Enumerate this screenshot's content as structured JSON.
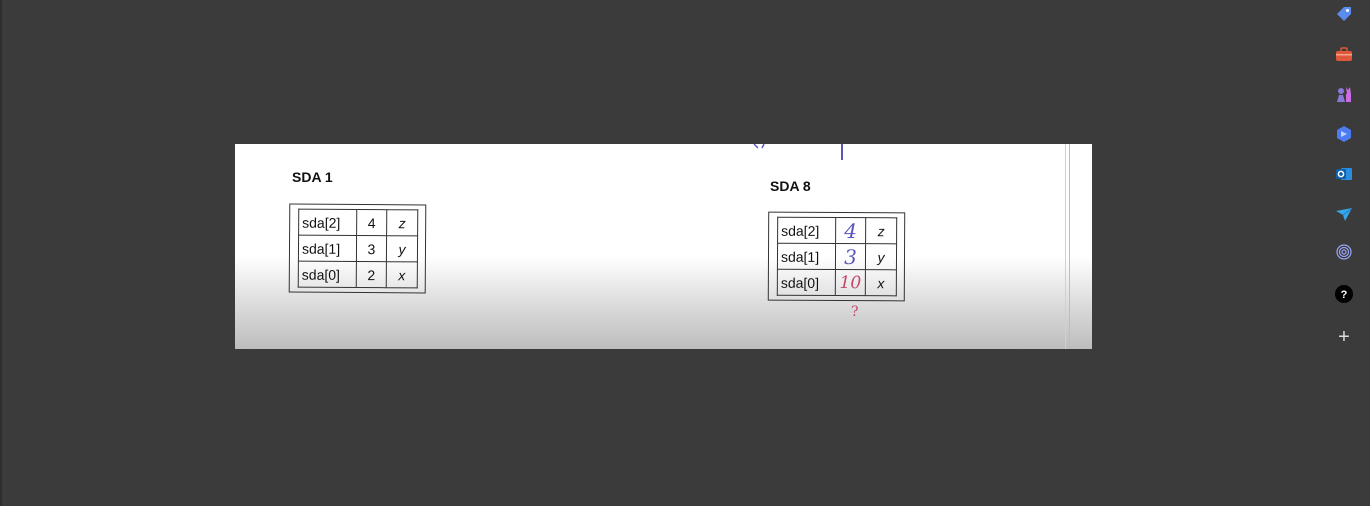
{
  "sidebar": {
    "icons": [
      {
        "name": "tag-icon",
        "color": "#5b8def"
      },
      {
        "name": "toolbox-icon",
        "color": "#e0583b"
      },
      {
        "name": "chess-icon",
        "color": "#b27ff5"
      },
      {
        "name": "copilot-icon",
        "color": "#4d7cf2"
      },
      {
        "name": "outlook-icon",
        "color": "#1a73c9"
      },
      {
        "name": "send-icon",
        "color": "#37a6e8"
      },
      {
        "name": "fingerprint-icon",
        "color": "#9aa3f5"
      },
      {
        "name": "help-icon",
        "color": "#000000"
      },
      {
        "name": "add-icon",
        "color": "#dddddd"
      }
    ],
    "help_glyph": "?",
    "add_glyph": "+"
  },
  "document": {
    "left": {
      "title": "SDA 1",
      "rows": [
        {
          "name": "sda[2]",
          "value": "4",
          "var": "z"
        },
        {
          "name": "sda[1]",
          "value": "3",
          "var": "y"
        },
        {
          "name": "sda[0]",
          "value": "2",
          "var": "x"
        }
      ]
    },
    "right": {
      "title": "SDA 8",
      "rows": [
        {
          "name": "sda[2]",
          "value": "4",
          "var": "z"
        },
        {
          "name": "sda[1]",
          "value": "3",
          "var": "y"
        },
        {
          "name": "sda[0]",
          "value": "10",
          "var": "x"
        }
      ],
      "annotation": "?"
    }
  }
}
